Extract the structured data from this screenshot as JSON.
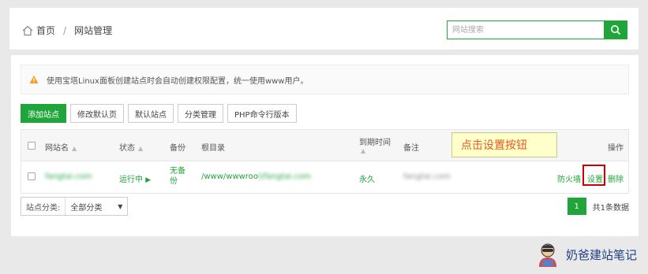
{
  "breadcrumb": {
    "home_label": "首页",
    "separator": "/",
    "current_label": "网站管理"
  },
  "search": {
    "placeholder": "网站搜索"
  },
  "notice": {
    "text": "使用宝塔Linux面板创建站点时会自动创建权限配置，统一使用www用户。"
  },
  "actions": {
    "add_site": "添加站点",
    "modify_default_page": "修改默认页",
    "default_site": "默认站点",
    "category_manage": "分类管理",
    "php_cli_version": "PHP命令行版本"
  },
  "table": {
    "headers": {
      "site_name": "网站名",
      "status": "状态",
      "backup": "备份",
      "root_dir": "根目录",
      "expiry_line1": "到期时间",
      "remark": "备注",
      "operation": "操作"
    },
    "rows": [
      {
        "site_name": "fangtai.com",
        "status": "运行中",
        "status_icon": "play-icon",
        "backup_line1": "无备",
        "backup_line2": "份",
        "root_prefix": "/www/wwwroo",
        "root_blurred": "t/fangtai.com",
        "expiry": "永久",
        "remark": "fangtai.com",
        "op_firewall": "防火墙",
        "op_settings": "设置",
        "op_delete": "删除"
      }
    ]
  },
  "tooltip": {
    "text": "点击设置按钮"
  },
  "footer": {
    "category_label": "站点分类:",
    "category_value": "全部分类",
    "current_page": "1",
    "total_text": "共1条数据"
  },
  "watermark": {
    "text": "奶爸建站笔记"
  },
  "colors": {
    "accent": "#20a53a",
    "warning": "#f0a024",
    "highlight_border": "#d00000",
    "tooltip_text": "#e65a1e",
    "tooltip_bg": "#ffffcc"
  }
}
